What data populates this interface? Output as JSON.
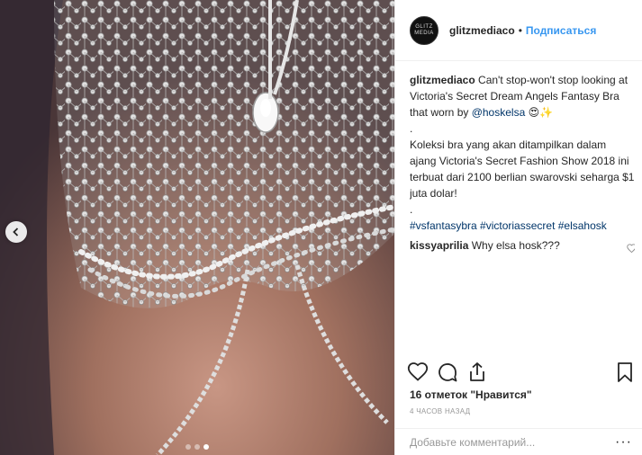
{
  "post": {
    "username": "glitzmediaco",
    "bullet": "•",
    "follow_label": "Подписаться",
    "avatar_text": "GLITZ MEDIA",
    "caption": {
      "user": "glitzmediaco",
      "text1": " Can't stop-won't stop looking at Victoria's Secret Dream Angels Fantasy Bra that worn by ",
      "mention": "@hoskelsa",
      "emoji": " 😍✨",
      "dot1": ".",
      "text2": "Koleksi bra yang akan ditampilkan dalam ajang Victoria's Secret Fashion Show 2018 ini terbuat dari 2100 berlian swarovski seharga $1 juta dolar!",
      "dot2": ".",
      "hashtags": "#vsfantasybra #victoriassecret #elsahosk"
    },
    "comment": {
      "user": "kissyaprilia",
      "text": " Why elsa hosk???"
    },
    "likes": "16 отметок \"Нравится\"",
    "time": "4 часов назад",
    "add_comment_placeholder": "Добавьте комментарий...",
    "more_label": "···"
  },
  "carousel": {
    "slide_count": 3,
    "active_index": 2
  },
  "icons": {
    "like": "heart-icon",
    "comment": "comment-icon",
    "share": "share-icon",
    "save": "bookmark-icon",
    "prev": "chevron-left-icon",
    "comment_like": "heart-icon"
  },
  "colors": {
    "link_blue": "#3897f0",
    "mention_blue": "#003569",
    "text": "#262626",
    "muted": "#999999",
    "border": "#efefef"
  }
}
